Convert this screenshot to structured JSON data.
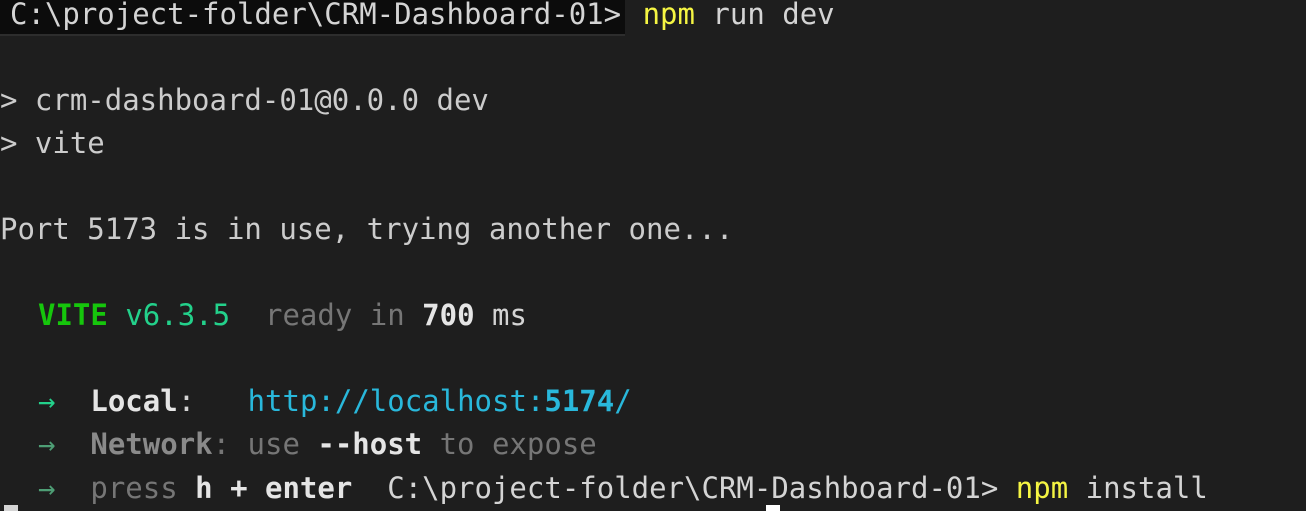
{
  "terminal": {
    "line1": {
      "prompt": "C:\\project-folder\\CRM-Dashboard-01>",
      "cmd_name": "npm",
      "cmd_args": " run dev"
    },
    "line2": {
      "text": "> crm-dashboard-01@0.0.0 dev"
    },
    "line3": {
      "text": "> vite"
    },
    "line4": {
      "text": "Port 5173 is in use, trying another one..."
    },
    "line5": {
      "brand": "VITE",
      "version": "v6.3.5",
      "ready_text": "ready in",
      "ready_value": "700",
      "ready_unit": "ms"
    },
    "line6": {
      "arrow": "→",
      "label": "Local",
      "colon": ":",
      "url_prefix": "http://localhost:",
      "url_port": "5174",
      "url_suffix": "/"
    },
    "line7": {
      "arrow": "→",
      "label": "Network",
      "text1": ": use ",
      "flag": "--host",
      "text2": " to expose"
    },
    "line8": {
      "arrow": "→",
      "text1": "press ",
      "key": "h + enter",
      "prompt": "C:\\project-folder\\CRM-Dashboard-01>",
      "cmd_name": "npm",
      "cmd_args": " install"
    }
  },
  "colors": {
    "background": "#1e1e1e",
    "text": "#cccccc",
    "command": "#f5f543",
    "vite_green": "#16c60c",
    "url": "#29b8db"
  }
}
